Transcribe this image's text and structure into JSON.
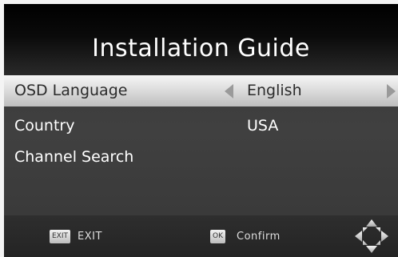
{
  "screen": {
    "title": "Installation Guide"
  },
  "menu": {
    "rows": [
      {
        "label": "OSD Language",
        "value": "English",
        "selected": true
      },
      {
        "label": "Country",
        "value": "USA",
        "selected": false
      },
      {
        "label": "Channel Search",
        "value": "",
        "selected": false
      }
    ]
  },
  "footer": {
    "exit": {
      "key": "EXIT",
      "label": "EXIT"
    },
    "ok": {
      "key": "OK",
      "label": "Confirm"
    }
  },
  "icons": {
    "left": "left-arrow-icon",
    "right": "right-arrow-icon",
    "dpad": "navigation-dpad-icon"
  }
}
